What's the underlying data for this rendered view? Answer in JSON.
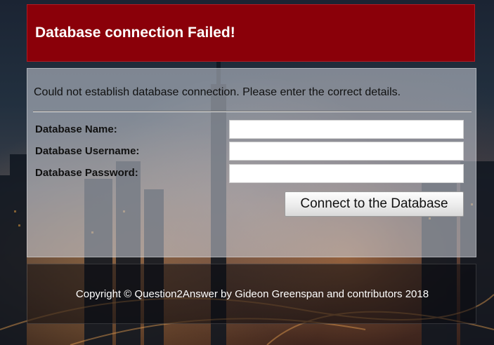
{
  "header": {
    "title": "Database connection Failed!"
  },
  "main": {
    "message": "Could not establish database connection. Please enter the correct details.",
    "fields": [
      {
        "label": "Database Name:",
        "value": ""
      },
      {
        "label": "Database Username:",
        "value": ""
      },
      {
        "label": "Database Password:",
        "value": ""
      }
    ],
    "connect_label": "Connect to the Database"
  },
  "footer": {
    "copyright": "Copyright © Question2Answer by Gideon Greenspan and contributors 2018"
  },
  "colors": {
    "header_bg": "#8a0009",
    "header_text": "#ffffff"
  }
}
